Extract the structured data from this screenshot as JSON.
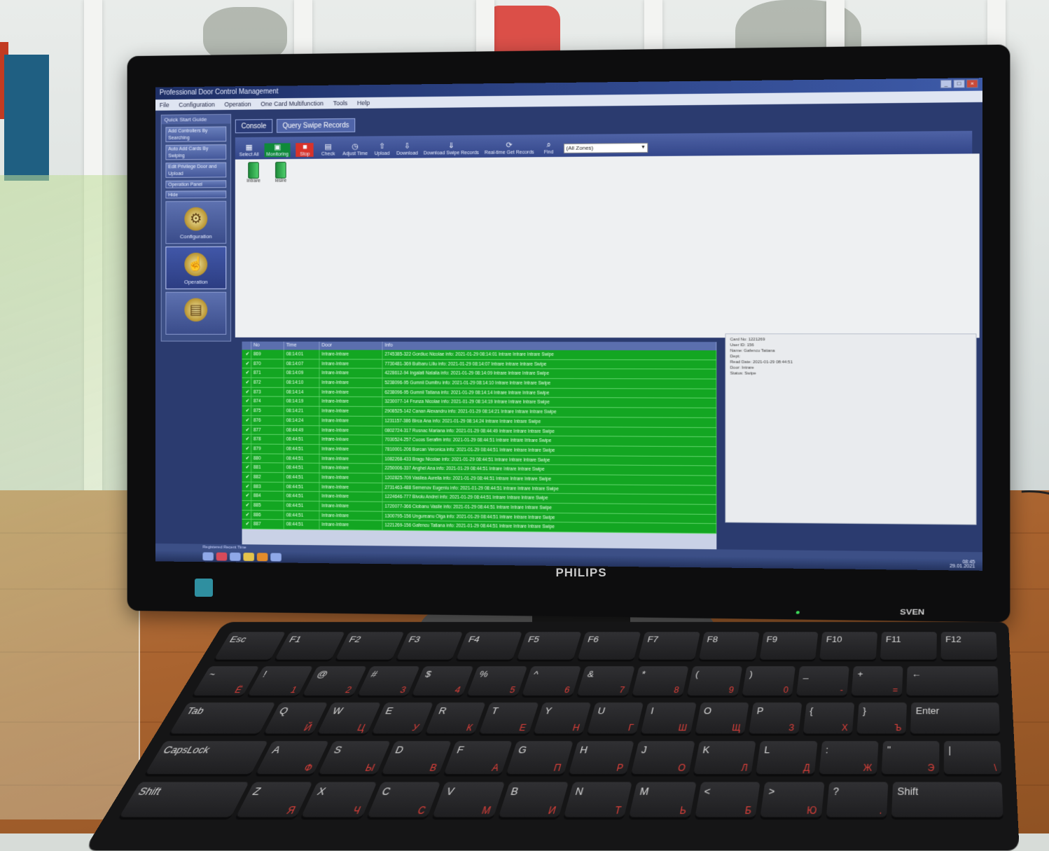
{
  "app": {
    "title": "Professional Door Control Management",
    "menu": [
      "File",
      "Configuration",
      "Operation",
      "One Card Multifunction",
      "Tools",
      "Help"
    ]
  },
  "left_panel": {
    "title": "Quick Start Guide",
    "buttons": [
      "Add Controllers By Searching",
      "Auto Add Cards By Swiping",
      "Edit Privilege Door and Upload",
      "Operation Panel",
      "Hide"
    ],
    "nav": [
      {
        "label": "Configuration",
        "icon": "gear-icon",
        "active": false
      },
      {
        "label": "Operation",
        "icon": "hand-icon",
        "active": true
      },
      {
        "label": "",
        "icon": "card-icon",
        "active": false
      }
    ]
  },
  "tabs": [
    "Console",
    "Query Swipe Records"
  ],
  "toolbar": {
    "buttons": [
      {
        "label": "Select All",
        "glyph": "▦",
        "state": "normal"
      },
      {
        "label": "Monitoring",
        "glyph": "▣",
        "state": "green"
      },
      {
        "label": "Stop",
        "glyph": "■",
        "state": "red"
      },
      {
        "label": "Check",
        "glyph": "▤",
        "state": "normal"
      },
      {
        "label": "Adjust Time",
        "glyph": "◷",
        "state": "normal"
      },
      {
        "label": "Upload",
        "glyph": "⇧",
        "state": "normal"
      },
      {
        "label": "Download",
        "glyph": "⇩",
        "state": "normal"
      },
      {
        "label": "Download Swipe Records",
        "glyph": "⇓",
        "state": "normal"
      },
      {
        "label": "Real-time Get Records",
        "glyph": "⟳",
        "state": "normal"
      },
      {
        "label": "Find",
        "glyph": "⌕",
        "state": "normal"
      }
    ],
    "door_filter": "(All Zones)"
  },
  "doors": [
    {
      "label": "Intrare"
    },
    {
      "label": "Iesire"
    }
  ],
  "grid": {
    "columns": [
      "",
      "No",
      "Time",
      "Door",
      "Info"
    ],
    "rows": [
      {
        "no": "869",
        "time": "08:14:01",
        "door": "Intrare-Intrare",
        "info": "2745385-322 Gordiuc Nicolae info: 2021-01-29 08:14:01 Intrare Intrare Intrare Swipe"
      },
      {
        "no": "870",
        "time": "08:14:07",
        "door": "Intrare-Intrare",
        "info": "7730481-369 Bulbaru Liliu info: 2021-01-29 08:14:07 Intrare Intrare Intrare Swipe"
      },
      {
        "no": "871",
        "time": "08:14:09",
        "door": "Intrare-Intrare",
        "info": "4228612-94 Ingalati Natalia info: 2021-01-29 08:14:09 Intrare Intrare Intrare Swipe"
      },
      {
        "no": "872",
        "time": "08:14:10",
        "door": "Intrare-Intrare",
        "info": "5238096-95 Gumnii Dumitru info: 2021-01-29 08:14:10 Intrare Intrare Intrare Swipe"
      },
      {
        "no": "873",
        "time": "08:14:14",
        "door": "Intrare-Intrare",
        "info": "6238096-95 Gumnii Tatiana info: 2021-01-29 08:14:14 Intrare Intrare Intrare Swipe"
      },
      {
        "no": "874",
        "time": "08:14:19",
        "door": "Intrare-Intrare",
        "info": "3230077-14 Frunza Nicolae info: 2021-01-29 08:14:19 Intrare Intrare Intrare Swipe"
      },
      {
        "no": "875",
        "time": "08:14:21",
        "door": "Intrare-Intrare",
        "info": "2908525-142 Canan Alexandru info: 2021-01-29 08:14:21 Intrare Intrare Intrare Swipe"
      },
      {
        "no": "876",
        "time": "08:14:24",
        "door": "Intrare-Intrare",
        "info": "1231157-386 Birca Ana info: 2021-01-29 08:14:24 Intrare Intrare Intrare Swipe"
      },
      {
        "no": "877",
        "time": "08:44:49",
        "door": "Intrare-Intrare",
        "info": "0802724-317 Rusnac Mariana info: 2021-01-29 08:44:49 Intrare Intrare Intrare Swipe"
      },
      {
        "no": "878",
        "time": "08:44:51",
        "door": "Intrare-Intrare",
        "info": "7030524-257 Cucos Serafim info: 2021-01-29 08:44:51 Intrare Intrare Intrare Swipe"
      },
      {
        "no": "879",
        "time": "08:44:51",
        "door": "Intrare-Intrare",
        "info": "7810001-206 Borcan Veronica info: 2021-01-29 08:44:51 Intrare Intrare Intrare Swipe"
      },
      {
        "no": "880",
        "time": "08:44:51",
        "door": "Intrare-Intrare",
        "info": "1082268-433 Bragu Nicolae info: 2021-01-29 08:44:51 Intrare Intrare Intrare Swipe"
      },
      {
        "no": "881",
        "time": "08:44:51",
        "door": "Intrare-Intrare",
        "info": "2250006-337 Anghel Ana info: 2021-01-29 08:44:51 Intrare Intrare Intrare Swipe"
      },
      {
        "no": "882",
        "time": "08:44:51",
        "door": "Intrare-Intrare",
        "info": "1202825-709 Vasilea Aurelia info: 2021-01-29 08:44:51 Intrare Intrare Intrare Swipe"
      },
      {
        "no": "883",
        "time": "08:44:51",
        "door": "Intrare-Intrare",
        "info": "2731463-488 Semenov Eugeniu info: 2021-01-29 08:44:51 Intrare Intrare Intrare Swipe"
      },
      {
        "no": "884",
        "time": "08:44:51",
        "door": "Intrare-Intrare",
        "info": "1224646-777 Bivolu Andrei info: 2021-01-29 08:44:51 Intrare Intrare Intrare Swipe"
      },
      {
        "no": "885",
        "time": "08:44:51",
        "door": "Intrare-Intrare",
        "info": "1720077-366 Ciobanu Vasile info: 2021-01-29 08:44:51 Intrare Intrare Intrare Swipe"
      },
      {
        "no": "886",
        "time": "08:44:51",
        "door": "Intrare-Intrare",
        "info": "1300795-156 Ungureanu Olga info: 2021-01-29 08:44:51 Intrare Intrare Intrare Swipe"
      },
      {
        "no": "887",
        "time": "08:44:51",
        "door": "Intrare-Intrare",
        "info": "1221269-156 Gafencu Tatiana info: 2021-01-29 08:44:51 Intrare Intrare Intrare Swipe"
      }
    ]
  },
  "detail": [
    "Card No: 1221269",
    "User ID: 156",
    "Name: Gafencu Tatiana",
    "Dept:",
    "Read Date: 2021-01-29 08:44:51",
    "Door: Intrare",
    "Status: Swipe"
  ],
  "statusbar": "Registered Recent Time",
  "clock": {
    "time": "08:45",
    "date": "29.01.2021"
  },
  "monitor": {
    "brand": "PHILIPS"
  },
  "keyboard": {
    "brand": "SVEN",
    "rows": [
      [
        {
          "l": "Esc"
        },
        {
          "l": "F1"
        },
        {
          "l": "F2"
        },
        {
          "l": "F3"
        },
        {
          "l": "F4"
        },
        {
          "l": "F5"
        },
        {
          "l": "F6"
        },
        {
          "l": "F7"
        },
        {
          "l": "F8"
        },
        {
          "l": "F9"
        },
        {
          "l": "F10"
        },
        {
          "l": "F11"
        },
        {
          "l": "F12"
        }
      ],
      [
        {
          "l": "~",
          "r": "Ё"
        },
        {
          "l": "!",
          "r": "1"
        },
        {
          "l": "@",
          "r": "2"
        },
        {
          "l": "#",
          "r": "3"
        },
        {
          "l": "$",
          "r": "4"
        },
        {
          "l": "%",
          "r": "5"
        },
        {
          "l": "^",
          "r": "6"
        },
        {
          "l": "&",
          "r": "7"
        },
        {
          "l": "*",
          "r": "8"
        },
        {
          "l": "(",
          "r": "9"
        },
        {
          "l": ")",
          "r": "0"
        },
        {
          "l": "_",
          "r": "-"
        },
        {
          "l": "+",
          "r": "="
        },
        {
          "l": "←"
        }
      ],
      [
        {
          "l": "Tab"
        },
        {
          "l": "Q",
          "r": "Й"
        },
        {
          "l": "W",
          "r": "Ц"
        },
        {
          "l": "E",
          "r": "У"
        },
        {
          "l": "R",
          "r": "К"
        },
        {
          "l": "T",
          "r": "Е"
        },
        {
          "l": "Y",
          "r": "Н"
        },
        {
          "l": "U",
          "r": "Г"
        },
        {
          "l": "I",
          "r": "Ш"
        },
        {
          "l": "O",
          "r": "Щ"
        },
        {
          "l": "P",
          "r": "З"
        },
        {
          "l": "{",
          "r": "Х"
        },
        {
          "l": "}",
          "r": "Ъ"
        },
        {
          "l": "Enter"
        }
      ],
      [
        {
          "l": "CapsLock"
        },
        {
          "l": "A",
          "r": "Ф"
        },
        {
          "l": "S",
          "r": "Ы"
        },
        {
          "l": "D",
          "r": "В"
        },
        {
          "l": "F",
          "r": "А"
        },
        {
          "l": "G",
          "r": "П"
        },
        {
          "l": "H",
          "r": "Р"
        },
        {
          "l": "J",
          "r": "О"
        },
        {
          "l": "K",
          "r": "Л"
        },
        {
          "l": "L",
          "r": "Д"
        },
        {
          "l": ":",
          "r": "Ж"
        },
        {
          "l": "\"",
          "r": "Э"
        },
        {
          "l": "|",
          "r": "\\"
        }
      ],
      [
        {
          "l": "Shift"
        },
        {
          "l": "Z",
          "r": "Я"
        },
        {
          "l": "X",
          "r": "Ч"
        },
        {
          "l": "C",
          "r": "С"
        },
        {
          "l": "V",
          "r": "М"
        },
        {
          "l": "B",
          "r": "И"
        },
        {
          "l": "N",
          "r": "Т"
        },
        {
          "l": "M",
          "r": "Ь"
        },
        {
          "l": "<",
          "r": "Б"
        },
        {
          "l": ">",
          "r": "Ю"
        },
        {
          "l": "?",
          "r": "."
        },
        {
          "l": "Shift"
        }
      ]
    ]
  }
}
